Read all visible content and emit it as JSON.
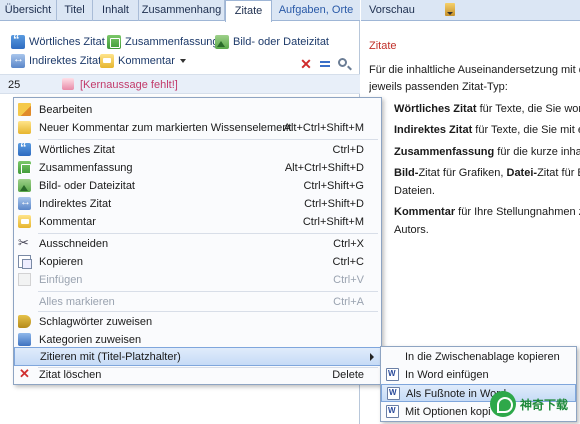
{
  "left": {
    "tabs": [
      {
        "label": "Übersicht"
      },
      {
        "label": "Titel"
      },
      {
        "label": "Inhalt"
      },
      {
        "label": "Zusammenhang"
      },
      {
        "label": "Zitate"
      },
      {
        "label": "Aufgaben, Orte"
      }
    ],
    "toolbar1": {
      "woertlich": "Wörtliches Zitat",
      "zusammenfassung": "Zusammenfassung",
      "bild": "Bild- oder Dateizitat"
    },
    "toolbar2": {
      "indirekt": "Indirektes Zitat",
      "kommentar": "Kommentar"
    },
    "row": {
      "number": "25",
      "text": "[Kernaussage fehlt!]"
    }
  },
  "right": {
    "tab": "Vorschau",
    "title": "Zitate",
    "intro1": "Für die inhaltliche Auseinandersetzung mit den",
    "intro2": "jeweils passenden Zitat-Typ:",
    "b1_bold": "Wörtliches Zitat",
    "b1_rest": " für Texte, die Sie wort- u",
    "b2_bold": "Indirektes Zitat",
    "b2_rest": " für Texte, die Sie mit eige",
    "b3_bold": "Zusammenfassung",
    "b3_rest": " für die kurze inhaltlic",
    "b4_bold1": "Bild-",
    "b4_mid1": "Zitat",
    "b4_mid2": " für Grafiken, ",
    "b4_bold2": "Datei-",
    "b4_mid3": "Zitat",
    "b4_rest": " für Be",
    "b4_line2": "Dateien.",
    "b5_bold": "Kommentar",
    "b5_rest": " für Ihre Stellungnahmen zu e",
    "b5_line2": "Autors."
  },
  "context_menu": {
    "items": [
      {
        "label": "Bearbeiten",
        "shortcut": ""
      },
      {
        "label": "Neuer Kommentar zum markierten Wissenselement",
        "shortcut": "Alt+Ctrl+Shift+M"
      },
      {
        "label": "Wörtliches Zitat",
        "shortcut": "Ctrl+D"
      },
      {
        "label": "Zusammenfassung",
        "shortcut": "Alt+Ctrl+Shift+D"
      },
      {
        "label": "Bild- oder Dateizitat",
        "shortcut": "Ctrl+Shift+G"
      },
      {
        "label": "Indirektes Zitat",
        "shortcut": "Ctrl+Shift+D"
      },
      {
        "label": "Kommentar",
        "shortcut": "Ctrl+Shift+M"
      },
      {
        "label": "Ausschneiden",
        "shortcut": "Ctrl+X"
      },
      {
        "label": "Kopieren",
        "shortcut": "Ctrl+C"
      },
      {
        "label": "Einfügen",
        "shortcut": "Ctrl+V"
      },
      {
        "label": "Alles markieren",
        "shortcut": "Ctrl+A"
      },
      {
        "label": "Schlagwörter zuweisen",
        "shortcut": ""
      },
      {
        "label": "Kategorien zuweisen",
        "shortcut": ""
      },
      {
        "label": "Zitieren mit  (Titel-Platzhalter)",
        "shortcut": ""
      },
      {
        "label": "Zitat löschen",
        "shortcut": "Delete"
      }
    ]
  },
  "submenu": {
    "items": [
      {
        "label": "In die Zwischenablage kopieren"
      },
      {
        "label": "In Word einfügen"
      },
      {
        "label": "Als Fußnote in Word"
      },
      {
        "label": "Mit Optionen kopi"
      }
    ]
  },
  "watermark": {
    "text": "神奇下载"
  }
}
